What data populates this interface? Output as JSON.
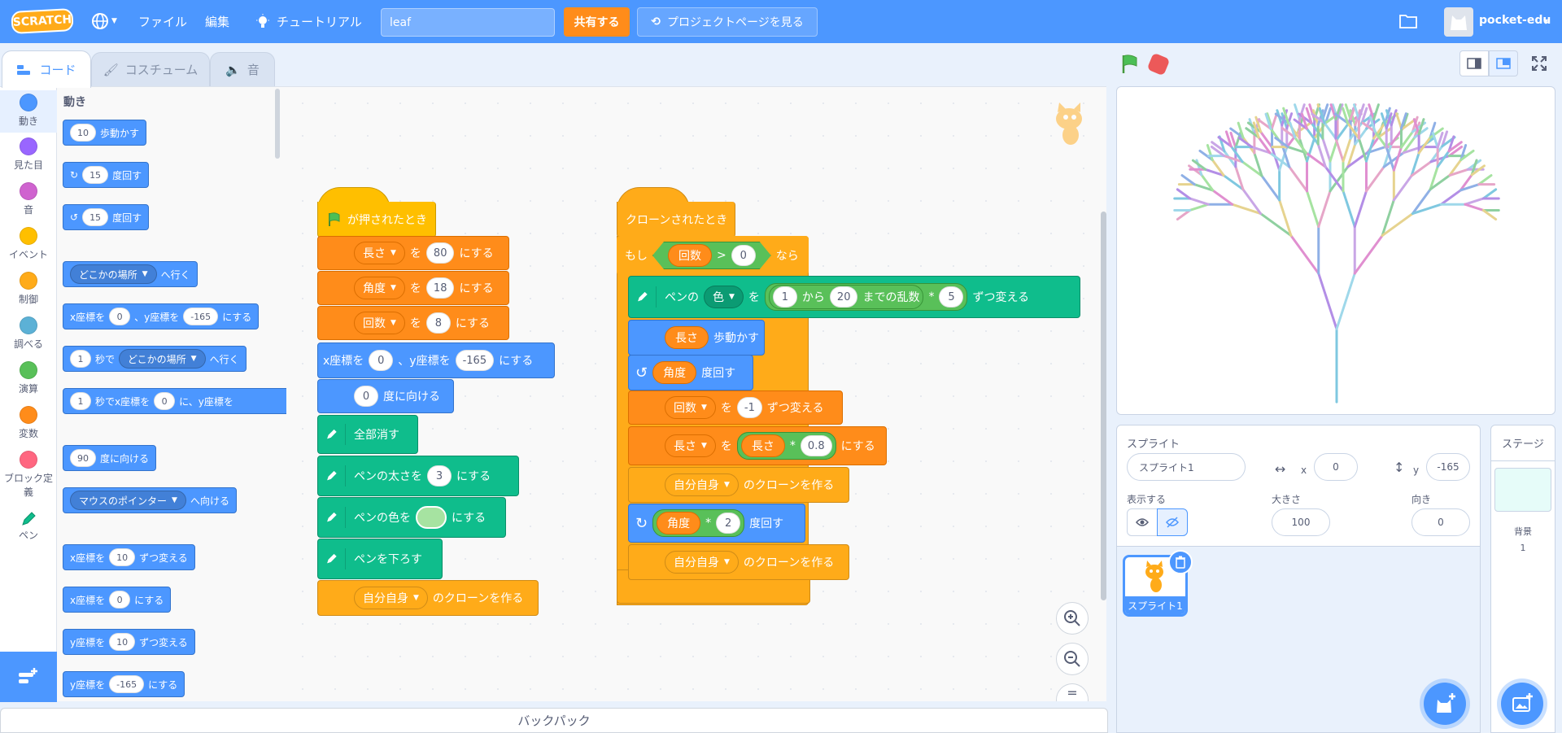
{
  "menubar": {
    "logo": "SCRATCH",
    "file": "ファイル",
    "edit": "編集",
    "tutorial": "チュートリアル",
    "project_title": "leaf",
    "share": "共有する",
    "see_project_page": "プロジェクトページを見る",
    "username": "pocket-edu",
    "accent_color": "#4c97ff"
  },
  "tabs": {
    "code": "コード",
    "costume": "コスチューム",
    "sound": "音"
  },
  "categories": [
    {
      "label": "動き",
      "color": "#4c97ff"
    },
    {
      "label": "見た目",
      "color": "#9966ff"
    },
    {
      "label": "音",
      "color": "#cf63cf"
    },
    {
      "label": "イベント",
      "color": "#ffbf00"
    },
    {
      "label": "制御",
      "color": "#ffab19"
    },
    {
      "label": "調べる",
      "color": "#5cb1d6"
    },
    {
      "label": "演算",
      "color": "#59c059"
    },
    {
      "label": "変数",
      "color": "#ff8c1a"
    },
    {
      "label": "ブロック定義",
      "color": "#ff6680"
    },
    {
      "label": "ペン",
      "color": "#0fbd8c"
    }
  ],
  "palette": {
    "title": "動き",
    "move": {
      "n": "10",
      "t": "歩動かす"
    },
    "turn_right": {
      "n": "15",
      "t": "度回す"
    },
    "turn_left": {
      "n": "15",
      "t": "度回す"
    },
    "goto": {
      "dd": "どこかの場所",
      "t": "へ行く"
    },
    "gotoxy": {
      "t1": "x座標を",
      "x": "0",
      "t2": "、y座標を",
      "y": "-165",
      "t3": "にする"
    },
    "glide": {
      "n": "1",
      "t1": "秒で",
      "dd": "どこかの場所",
      "t2": "へ行く"
    },
    "glidexy": {
      "n": "1",
      "t1": "秒でx座標を",
      "x": "0",
      "t2": "に、y座標を"
    },
    "point": {
      "n": "90",
      "t": "度に向ける"
    },
    "point_towards": {
      "dd": "マウスのポインター",
      "t": "へ向ける"
    },
    "change_x": {
      "t1": "x座標を",
      "n": "10",
      "t2": "ずつ変える"
    },
    "set_x": {
      "t1": "x座標を",
      "n": "0",
      "t2": "にする"
    },
    "change_y": {
      "t1": "y座標を",
      "n": "10",
      "t2": "ずつ変える"
    },
    "set_y": {
      "t1": "y座標を",
      "n": "-165",
      "t2": "にする"
    }
  },
  "script1": {
    "hat": "が押されたとき",
    "set_len": {
      "var": "長さ",
      "t1": "を",
      "v": "80",
      "t2": "にする"
    },
    "set_angle": {
      "var": "角度",
      "t1": "を",
      "v": "18",
      "t2": "にする"
    },
    "set_count": {
      "var": "回数",
      "t1": "を",
      "v": "8",
      "t2": "にする"
    },
    "gotoxy": {
      "t1": "x座標を",
      "x": "0",
      "t2": "、y座標を",
      "y": "-165",
      "t3": "にする"
    },
    "point": {
      "v": "0",
      "t": "度に向ける"
    },
    "clear": "全部消す",
    "pen_size": {
      "t1": "ペンの太さを",
      "v": "3",
      "t2": "にする"
    },
    "pen_color": {
      "t1": "ペンの色を",
      "t2": "にする",
      "swatch": "#a6e3a1"
    },
    "pen_down": "ペンを下ろす",
    "clone": {
      "dd": "自分自身",
      "t": "のクローンを作る"
    }
  },
  "script2": {
    "hat": "クローンされたとき",
    "if": {
      "t1": "もし",
      "var": "回数",
      "op": ">",
      "v": "0",
      "t2": "なら"
    },
    "change_pen": {
      "t1": "ペンの",
      "dd": "色",
      "t2": "を",
      "a": "1",
      "t3": "から",
      "b": "20",
      "t4": "までの乱数",
      "mul": "*",
      "c": "5",
      "t5": "ずつ変える"
    },
    "move": {
      "var": "長さ",
      "t": "歩動かす"
    },
    "turn_left": {
      "var": "角度",
      "t": "度回す"
    },
    "change_count": {
      "var": "回数",
      "t1": "を",
      "v": "-1",
      "t2": "ずつ変える"
    },
    "set_len": {
      "var": "長さ",
      "t1": "を",
      "rep": "長さ",
      "mul": "*",
      "v": "0.8",
      "t2": "にする"
    },
    "clone1": {
      "dd": "自分自身",
      "t": "のクローンを作る"
    },
    "turn_right": {
      "var": "角度",
      "mul": "*",
      "v": "2",
      "t": "度回す"
    },
    "clone2": {
      "dd": "自分自身",
      "t": "のクローンを作る"
    }
  },
  "backpack": "バックパック",
  "sprite_info": {
    "sprite_label": "スプライト",
    "sprite_name": "スプライト1",
    "x_label": "x",
    "x": "0",
    "y_label": "y",
    "y": "-165",
    "show_label": "表示する",
    "size_label": "大きさ",
    "size": "100",
    "direction_label": "向き",
    "direction": "0"
  },
  "sprite_list": [
    {
      "name": "スプライト1"
    }
  ],
  "stage_panel": {
    "title": "ステージ",
    "backdrop_label": "背景",
    "backdrop_count": "1"
  }
}
